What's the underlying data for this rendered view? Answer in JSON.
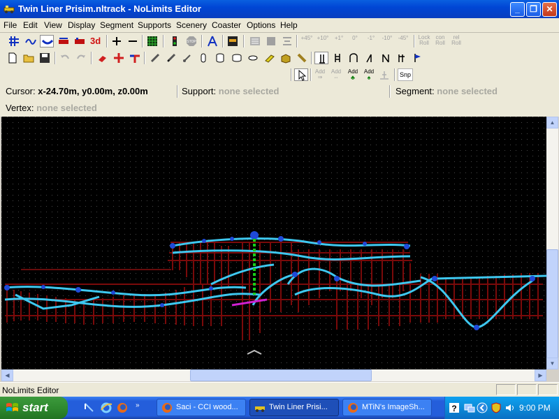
{
  "window": {
    "title": "Twin Liner Prisim.nltrack - NoLimits Editor",
    "icon": "roller-coaster-icon",
    "controls": [
      "minimize",
      "maximize",
      "close"
    ]
  },
  "menu": [
    {
      "key": "file",
      "label": "File"
    },
    {
      "key": "edit",
      "label": "Edit"
    },
    {
      "key": "view",
      "label": "View"
    },
    {
      "key": "display",
      "label": "Display"
    },
    {
      "key": "segment",
      "label": "Segment"
    },
    {
      "key": "supports",
      "label": "Supports"
    },
    {
      "key": "scenery",
      "label": "Scenery"
    },
    {
      "key": "coaster",
      "label": "Coaster"
    },
    {
      "key": "options",
      "label": "Options"
    },
    {
      "key": "help",
      "label": "Help"
    }
  ],
  "toolbar1": {
    "view_3d_label": "3d",
    "stop_label": "STOP",
    "roll_buttons": [
      "+45°",
      "+10°",
      "+1°",
      "0°",
      "-1°",
      "-10°",
      "-45°"
    ],
    "lock_roll": [
      "Lock",
      "Roll"
    ],
    "con_roll": [
      "con",
      "Roll"
    ],
    "rel_roll": [
      "rel",
      "Roll"
    ]
  },
  "toolbar3": {
    "add_labels": [
      "Add",
      "Add",
      "Add",
      "Add"
    ],
    "snap_label": "Snp"
  },
  "status_fields": {
    "cursor_label": "Cursor:",
    "cursor_value": "x-24.70m, y0.00m, z0.00m",
    "support_label": "Support:",
    "support_value": "none selected",
    "segment_label": "Segment:",
    "segment_value": "none selected",
    "vertex_label": "Vertex:",
    "vertex_value": "none selected"
  },
  "viewport": {
    "background": "#000000",
    "track_color": "#3ec8f0",
    "support_color": "#7a0a0a",
    "node_color": "#1f4ad8",
    "highlight_green": "#18d018",
    "highlight_magenta": "#d020d0"
  },
  "statusbar": {
    "text": "NoLimits Editor"
  },
  "taskbar": {
    "start_label": "start",
    "tasks": [
      {
        "label": "Saci - CCI wood...",
        "icon": "firefox-icon"
      },
      {
        "label": "Twin Liner Prisi...",
        "icon": "roller-coaster-icon"
      },
      {
        "label": "MTiN's ImageSh...",
        "icon": "firefox-icon"
      }
    ],
    "clock": "9:00 PM"
  }
}
